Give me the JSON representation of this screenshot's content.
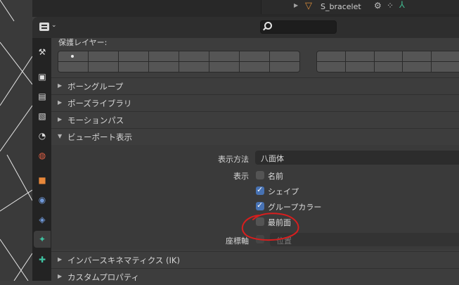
{
  "outliner": {
    "item_name": "S_bracelet",
    "colors": {
      "bone": "#d98b3a",
      "data": "#3fb28a"
    }
  },
  "header": {
    "editor_type_icon": "properties-editor-icon",
    "search": {
      "value": "",
      "placeholder": ""
    }
  },
  "tabs": [
    {
      "icon": "tool-icon",
      "glyph": "⚒"
    },
    {
      "icon": "render-icon",
      "glyph": "▣"
    },
    {
      "icon": "output-icon",
      "glyph": "▤"
    },
    {
      "icon": "view-layer-icon",
      "glyph": "▧"
    },
    {
      "icon": "scene-icon",
      "glyph": "◔"
    },
    {
      "icon": "world-icon",
      "glyph": "◍"
    },
    {
      "icon": "object-icon",
      "glyph": "■"
    },
    {
      "icon": "modifier-icon",
      "glyph": "◉"
    },
    {
      "icon": "physics-icon",
      "glyph": "◈"
    },
    {
      "icon": "armature-data-icon",
      "glyph": "✦",
      "active": true
    },
    {
      "icon": "bone-icon",
      "glyph": "✚"
    }
  ],
  "protected_layers_label": "保護レイヤー:",
  "panels": {
    "bone_groups": "ボーングループ",
    "pose_library": "ポーズライブラリ",
    "motion_paths": "モーションパス",
    "viewport_display": "ビューポート表示",
    "inverse_kinematics": "インバースキネマティクス (IK)",
    "custom_properties": "カスタムプロパティ"
  },
  "viewport_display": {
    "display_as_label": "表示方法",
    "display_as_value": "八面体",
    "show_label": "表示",
    "names": {
      "label": "名前",
      "checked": false
    },
    "shapes": {
      "label": "シェイプ",
      "checked": true
    },
    "group_colors": {
      "label": "グループカラー",
      "checked": true
    },
    "in_front": {
      "label": "最前面",
      "checked": false
    },
    "axes_label": "座標軸",
    "axes_position": "位置"
  },
  "annotation_color": "#d81e1e"
}
